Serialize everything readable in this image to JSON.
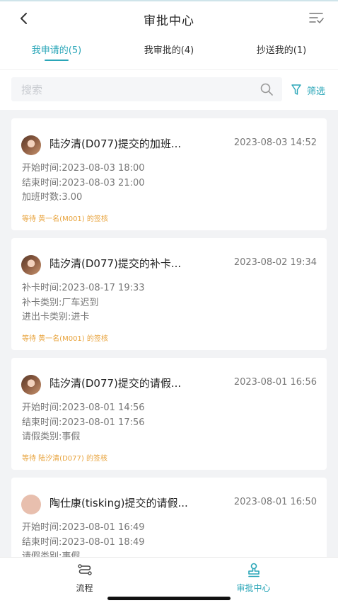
{
  "colors": {
    "accent": "#2aa6b8",
    "status": "#e8a33c",
    "background": "#f2f3f5"
  },
  "header": {
    "back_icon": "chevron-left-icon",
    "title": "审批中心",
    "sort_icon": "sort-list-icon",
    "tabs": [
      {
        "label": "我申请的(5)",
        "active": true
      },
      {
        "label": "我审批的(4)",
        "active": false
      },
      {
        "label": "抄送我的(1)",
        "active": false
      }
    ]
  },
  "search": {
    "placeholder": "搜索",
    "value": "",
    "icon": "search-icon",
    "filter_label": "筛选",
    "filter_icon": "funnel-icon"
  },
  "items": [
    {
      "title": "陆汐清(D077)提交的加班...",
      "time": "2023-08-03 14:52",
      "avatar": "photo",
      "details": [
        "开始时间:2023-08-03 18:00",
        "结束时间:2023-08-03 21:00",
        "加班时数:3.00"
      ],
      "status": "等待 黄一名(M001) 的签核"
    },
    {
      "title": "陆汐清(D077)提交的补卡...",
      "time": "2023-08-02 19:34",
      "avatar": "photo",
      "details": [
        "补卡时间:2023-08-17 19:33",
        "补卡类别:厂车迟到",
        "进出卡类别:进卡"
      ],
      "status": "等待 黄一名(M001) 的签核"
    },
    {
      "title": "陆汐清(D077)提交的请假...",
      "time": "2023-08-01 16:56",
      "avatar": "photo",
      "details": [
        "开始时间:2023-08-01 14:56",
        "结束时间:2023-08-01 17:56",
        "请假类别:事假"
      ],
      "status": "等待 陆汐清(D077) 的签核"
    },
    {
      "title": "陶仕康(tisking)提交的请假...",
      "time": "2023-08-01 16:50",
      "avatar": "plain",
      "details": [
        "开始时间:2023-08-01 16:49",
        "结束时间:2023-08-01 18:49",
        "请假类别:事假"
      ],
      "status": ""
    }
  ],
  "bottom_nav": [
    {
      "label": "流程",
      "icon": "flow-icon",
      "active": false
    },
    {
      "label": "审批中心",
      "icon": "stamp-icon",
      "active": true
    }
  ]
}
